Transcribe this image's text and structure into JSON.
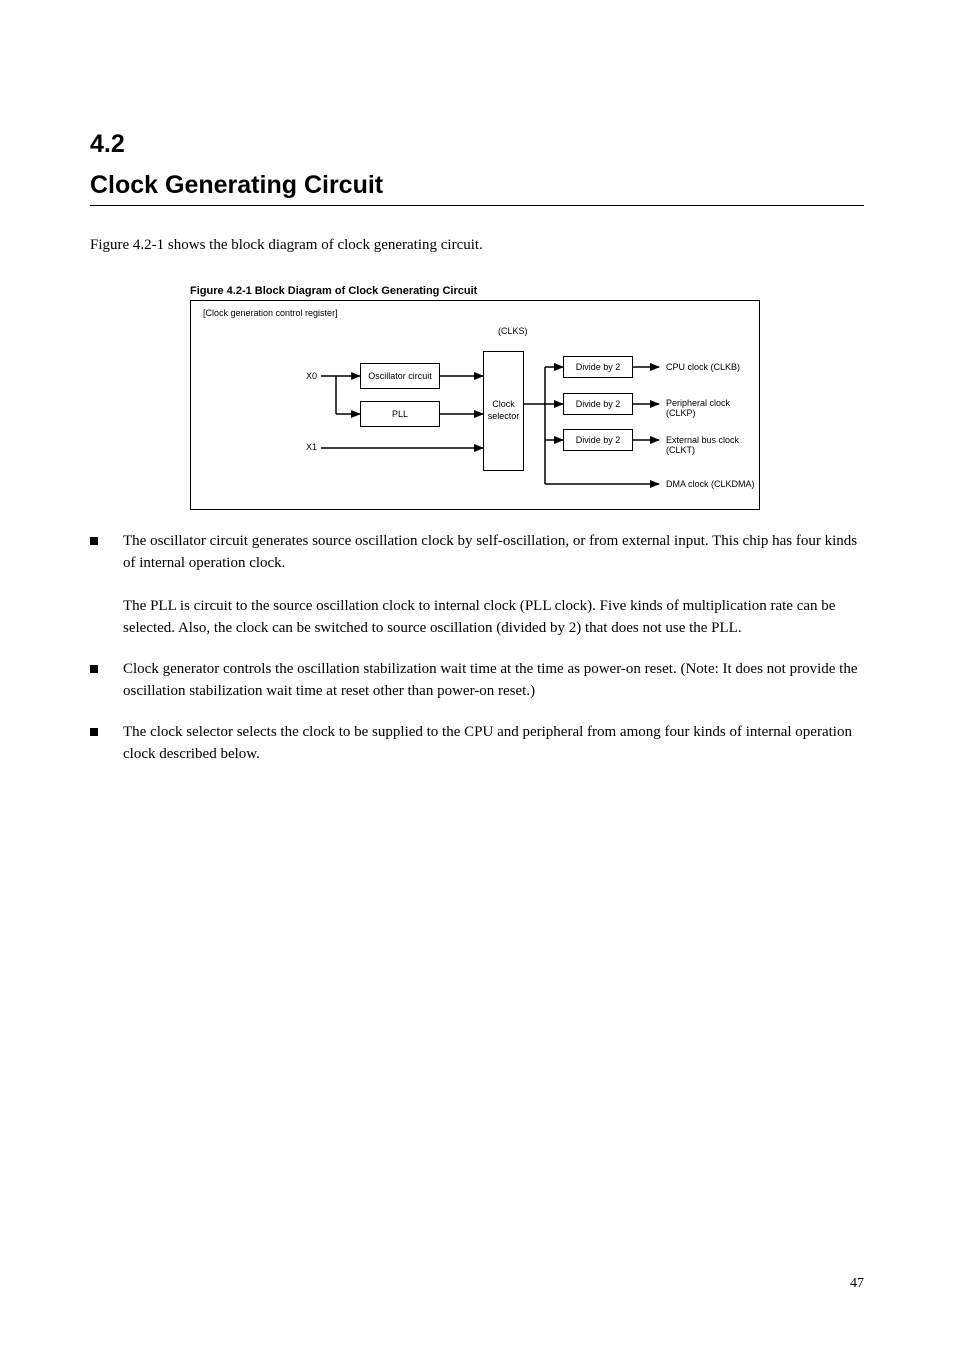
{
  "section": {
    "number": "4.2",
    "title": "Clock Generating Circuit"
  },
  "intro": "Figure 4.2-1 shows the block diagram of clock generating circuit.",
  "figure": {
    "caption": "Figure 4.2-1  Block Diagram of Clock Generating Circuit",
    "containerLabel": "[Clock generation control register]",
    "clksLabel": "(CLKS)",
    "blocks": {
      "osc": "Oscillator circuit",
      "pll": "PLL",
      "selector": "Clock selector",
      "div2a": "Divide by 2",
      "div2b": "Divide by 2",
      "div2c": "Divide by 2"
    },
    "signals": {
      "X0": "X0",
      "X1": "X1",
      "PLLclk": "CPU clock (CLKB)",
      "Busclk": "Peripheral clock (CLKP)",
      "Extclk": "External bus clock (CLKT)",
      "Dmaclk": "DMA clock (CLKDMA)"
    }
  },
  "bullets": [
    {
      "paras": [
        "The oscillator circuit generates source oscillation clock by self-oscillation, or from external input. This chip has four kinds of internal operation clock.",
        "The PLL is circuit to the source oscillation clock to internal clock (PLL clock). Five kinds of multiplication rate can be selected. Also, the clock can be switched to source oscillation (divided by 2) that does not use the PLL."
      ]
    },
    {
      "paras": [
        "Clock generator controls the oscillation stabilization wait time at the time as power-on reset. (Note: It does not provide the oscillation stabilization wait time at reset other than power-on reset.)"
      ]
    },
    {
      "paras": [
        "The clock selector selects the clock to be supplied to the CPU and peripheral from among four kinds of internal operation clock described below."
      ]
    }
  ],
  "pageNumber": "47"
}
